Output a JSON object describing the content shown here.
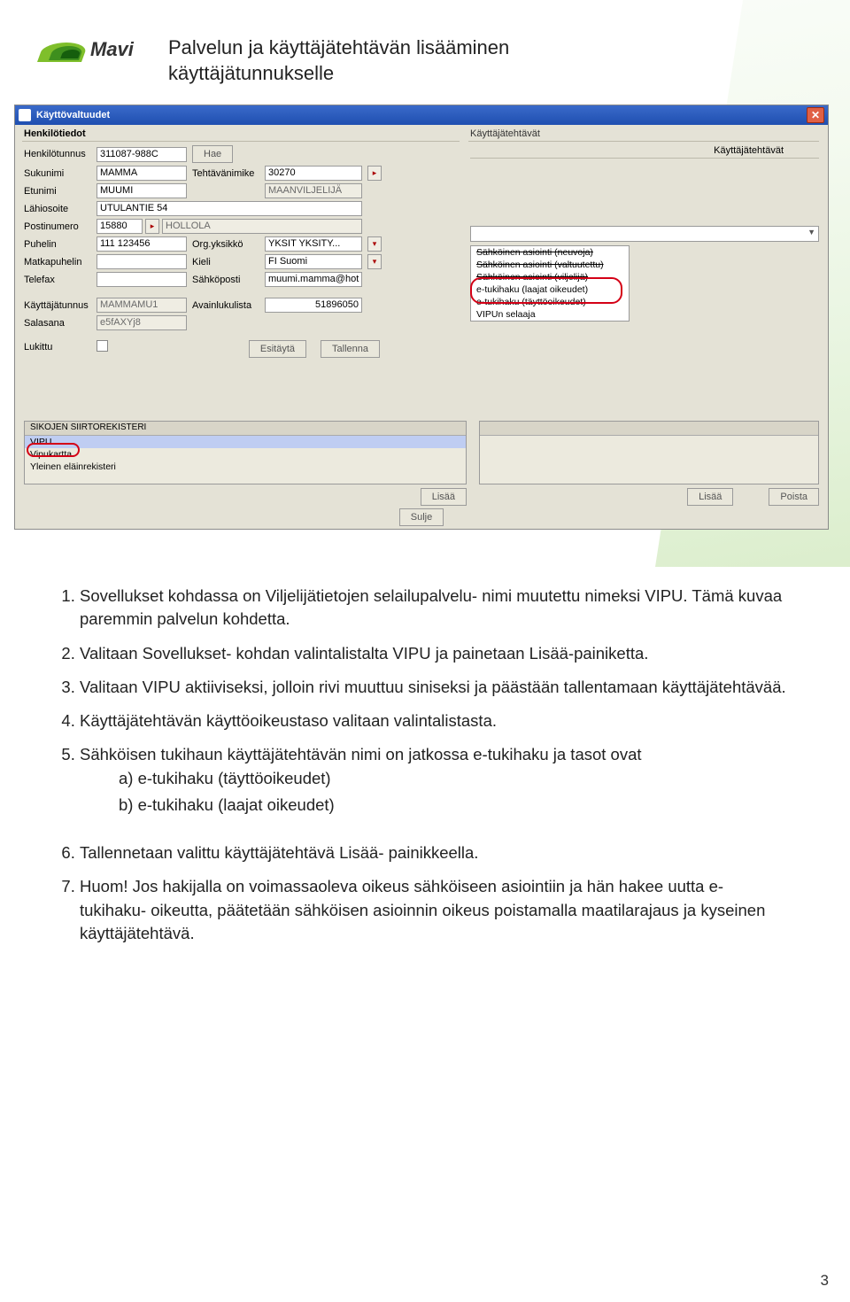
{
  "document": {
    "logo_text": "Mavi",
    "title_line1": "Palvelun ja käyttäjätehtävän lisääminen",
    "title_line2": "käyttäjätunnukselle",
    "page_number": "3"
  },
  "window": {
    "title": "Käyttövaltuudet",
    "left_group": "Henkilötiedot",
    "right_group": "Käyttäjätehtävät",
    "right_float_title": "Käyttäjätehtävät",
    "labels": {
      "henkilotunnus": "Henkilötunnus",
      "sukunimi": "Sukunimi",
      "etunimi": "Etunimi",
      "lahiosoite": "Lähiosoite",
      "postinumero": "Postinumero",
      "puhelin": "Puhelin",
      "matkapuhelin": "Matkapuhelin",
      "telefax": "Telefax",
      "kayttajatunnus": "Käyttäjätunnus",
      "salasana": "Salasana",
      "lukittu": "Lukittu",
      "tehtavanimike": "Tehtävänimike",
      "orgyksikko": "Org.yksikkö",
      "kieli": "Kieli",
      "sahkoposti": "Sähköposti",
      "avainlukulista": "Avainlukulista"
    },
    "values": {
      "henkilotunnus": "311087-988C",
      "sukunimi": "MAMMA",
      "etunimi": "MUUMI",
      "lahiosoite": "UTULANTIE 54",
      "postinumero": "15880",
      "postitoimipaikka": "HOLLOLA",
      "puhelin": "111 123456",
      "matkapuhelin": "",
      "telefax": "",
      "kayttajatunnus": "MAMMAMU1",
      "salasana": "e5fAXYj8",
      "tehtavanimike_code": "30270",
      "tehtavanimike_text": "MAANVILJELIJÄ",
      "orgyksikko": "YKSIT   YKSITY...",
      "kieli": "FI   Suomi",
      "sahkoposti": "muumi.mamma@hot",
      "avainlukulista": "51896050"
    },
    "buttons": {
      "hae": "Hae",
      "esitayta": "Esitäytä",
      "tallenna": "Tallenna",
      "lisaa": "Lisää",
      "poista": "Poista",
      "sulje": "Sulje"
    },
    "role_list": [
      "Sähköinen asiointi (neuvoja)",
      "Sähköinen asiointi (valtuutettu)",
      "Sähköinen asiointi (viljelijä)",
      "e-tukihaku (laajat oikeudet)",
      "e-tukihaku (täyttöoikeudet)",
      "VIPUn selaaja"
    ],
    "lower_list": {
      "header": "SIKOJEN SIIRTOREKISTERI",
      "rows": [
        "VIPU",
        "Vipukartta",
        "Yleinen eläinrekisteri"
      ]
    }
  },
  "body": {
    "items": {
      "1": "Sovellukset kohdassa on Viljelijätietojen selailupalvelu- nimi muutettu nimeksi VIPU. Tämä kuvaa paremmin palvelun kohdetta.",
      "2": "Valitaan Sovellukset- kohdan valintalistalta VIPU ja painetaan Lisää-painiketta.",
      "3": "Valitaan VIPU aktiiviseksi, jolloin rivi muuttuu siniseksi ja päästään tallentamaan käyttäjätehtävää.",
      "4": "Käyttäjätehtävän käyttöoikeustaso valitaan valintalistasta.",
      "5": "Sähköisen tukihaun käyttäjätehtävän nimi on jatkossa e-tukihaku ja tasot ovat",
      "5a": "a) e-tukihaku (täyttöoikeudet)",
      "5b": "b) e-tukihaku (laajat oikeudet)",
      "6": "Tallennetaan valittu käyttäjätehtävä Lisää- painikkeella.",
      "7": "Huom! Jos hakijalla on voimassaoleva oikeus sähköiseen asiointiin ja hän hakee uutta e-tukihaku- oikeutta, päätetään sähköisen asioinnin oikeus poistamalla maatilarajaus ja kyseinen käyttäjätehtävä."
    }
  }
}
